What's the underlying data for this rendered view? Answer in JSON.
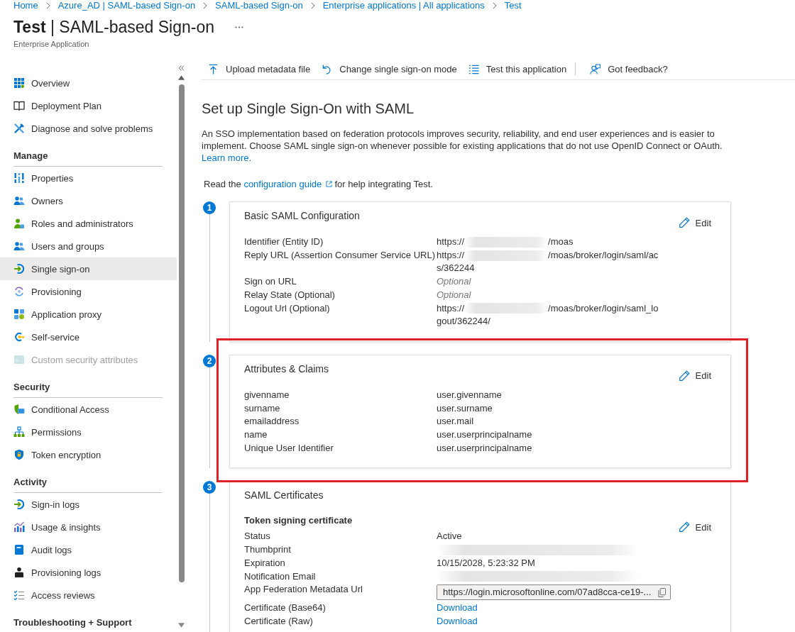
{
  "breadcrumb": [
    "Home",
    "Azure_AD | SAML-based Sign-on",
    "SAML-based Sign-on",
    "Enterprise applications | All applications",
    "Test"
  ],
  "page": {
    "title": "**Test** | SAML-based Sign-on",
    "subtitle": "Enterprise Application"
  },
  "sidebar": {
    "sections": [
      {
        "items": [
          {
            "label": "Overview",
            "selected": false,
            "disabled": false
          },
          {
            "label": "Deployment Plan",
            "selected": false,
            "disabled": false
          },
          {
            "label": "Diagnose and solve problems",
            "selected": false,
            "disabled": false
          }
        ]
      },
      {
        "title": "Manage",
        "items": [
          {
            "label": "Properties",
            "selected": false,
            "disabled": false
          },
          {
            "label": "Owners",
            "selected": false,
            "disabled": false
          },
          {
            "label": "Roles and administrators",
            "selected": false,
            "disabled": false
          },
          {
            "label": "Users and groups",
            "selected": false,
            "disabled": false
          },
          {
            "label": "Single sign-on",
            "selected": true,
            "disabled": false
          },
          {
            "label": "Provisioning",
            "selected": false,
            "disabled": false
          },
          {
            "label": "Application proxy",
            "selected": false,
            "disabled": false
          },
          {
            "label": "Self-service",
            "selected": false,
            "disabled": false
          },
          {
            "label": "Custom security attributes",
            "selected": false,
            "disabled": true
          }
        ]
      },
      {
        "title": "Security",
        "items": [
          {
            "label": "Conditional Access",
            "selected": false,
            "disabled": false
          },
          {
            "label": "Permissions",
            "selected": false,
            "disabled": false
          },
          {
            "label": "Token encryption",
            "selected": false,
            "disabled": false
          }
        ]
      },
      {
        "title": "Activity",
        "items": [
          {
            "label": "Sign-in logs",
            "selected": false,
            "disabled": false
          },
          {
            "label": "Usage & insights",
            "selected": false,
            "disabled": false
          },
          {
            "label": "Audit logs",
            "selected": false,
            "disabled": false
          },
          {
            "label": "Provisioning logs",
            "selected": false,
            "disabled": false
          },
          {
            "label": "Access reviews",
            "selected": false,
            "disabled": false
          }
        ]
      },
      {
        "title": "Troubleshooting + Support"
      }
    ]
  },
  "toolbar": {
    "actions": [
      "Upload metadata file",
      "Change single sign-on mode",
      "Test this application"
    ],
    "feedback": "Got feedback?"
  },
  "setup": {
    "heading": "Set up Single Sign-On with SAML",
    "intro": {
      "text": "An SSO implementation based on federation protocols improves security, reliability, and end user experiences and is easier to implement. Choose SAML single sign-on whenever possible for existing applications that do not use OpenID Connect or OAuth.",
      "link": "Learn more."
    },
    "guide": {
      "before": "Read the",
      "link": "configuration guide",
      "after": "for help integrating Test."
    },
    "steps": [
      {
        "number": "1",
        "highlighted": false,
        "card": {
          "title": "Basic SAML Configuration",
          "edit": "Edit",
          "rows": [
            {
              "label": "Identifier (Entity ID)",
              "lines": [
                [
                  {
                    "kind": "text",
                    "text": "https://"
                  },
                  {
                    "kind": "redacted"
                  },
                  {
                    "kind": "text",
                    "text": "/moas"
                  }
                ]
              ]
            },
            {
              "label": "Reply URL (Assertion Consumer Service URL)",
              "lines": [
                [
                  {
                    "kind": "text",
                    "text": "https://"
                  },
                  {
                    "kind": "redacted"
                  },
                  {
                    "kind": "text",
                    "text": "/moas/broker/login/saml/ac"
                  }
                ],
                [
                  {
                    "kind": "text",
                    "text": "s/362244"
                  }
                ]
              ]
            },
            {
              "label": "Sign on URL",
              "lines": [
                [
                  {
                    "kind": "hint",
                    "text": "Optional"
                  }
                ]
              ]
            },
            {
              "label": "Relay State (Optional)",
              "lines": [
                [
                  {
                    "kind": "hint",
                    "text": "Optional"
                  }
                ]
              ]
            },
            {
              "label": "Logout Url (Optional)",
              "lines": [
                [
                  {
                    "kind": "text",
                    "text": "https://"
                  },
                  {
                    "kind": "redacted"
                  },
                  {
                    "kind": "text",
                    "text": "/moas/broker/login/saml_lo"
                  }
                ],
                [
                  {
                    "kind": "text",
                    "text": "gout/362244/"
                  }
                ]
              ]
            }
          ]
        }
      },
      {
        "number": "2",
        "highlighted": true,
        "card": {
          "title": "Attributes & Claims",
          "edit": "Edit",
          "rows": [
            {
              "label": "givenname",
              "lines": [
                [
                  {
                    "kind": "text",
                    "text": "user.givenname"
                  }
                ]
              ]
            },
            {
              "label": "surname",
              "lines": [
                [
                  {
                    "kind": "text",
                    "text": "user.surname"
                  }
                ]
              ]
            },
            {
              "label": "emailaddress",
              "lines": [
                [
                  {
                    "kind": "text",
                    "text": "user.mail"
                  }
                ]
              ]
            },
            {
              "label": "name",
              "lines": [
                [
                  {
                    "kind": "text",
                    "text": "user.userprincipalname"
                  }
                ]
              ]
            },
            {
              "label": "Unique User Identifier",
              "lines": [
                [
                  {
                    "kind": "text",
                    "text": "user.userprincipalname"
                  }
                ]
              ]
            }
          ]
        }
      },
      {
        "number": "3",
        "highlighted": false,
        "card": {
          "title": "SAML Certificates",
          "subtitle": "Token signing certificate",
          "edit": "Edit",
          "rows": [
            {
              "label": "Status",
              "lines": [
                [
                  {
                    "kind": "text",
                    "text": "Active"
                  }
                ]
              ]
            },
            {
              "label": "Thumbprint",
              "lines": [
                [
                  {
                    "kind": "redacted"
                  }
                ]
              ]
            },
            {
              "label": "Expiration",
              "lines": [
                [
                  {
                    "kind": "text",
                    "text": "10/15/2028, 5:23:32 PM"
                  }
                ]
              ]
            },
            {
              "label": "Notification Email",
              "lines": [
                [
                  {
                    "kind": "redacted"
                  }
                ]
              ]
            },
            {
              "label": "App Federation Metadata Url",
              "lines": [
                [
                  {
                    "kind": "field",
                    "text": "https://login.microsoftonline.com/07ad8cca-ce19-..."
                  }
                ]
              ]
            },
            {
              "label": "Certificate (Base64)",
              "lines": [
                [
                  {
                    "kind": "link",
                    "text": "Download"
                  }
                ]
              ]
            },
            {
              "label": "Certificate (Raw)",
              "lines": [
                [
                  {
                    "kind": "link",
                    "text": "Download"
                  }
                ]
              ]
            }
          ]
        }
      }
    ]
  }
}
